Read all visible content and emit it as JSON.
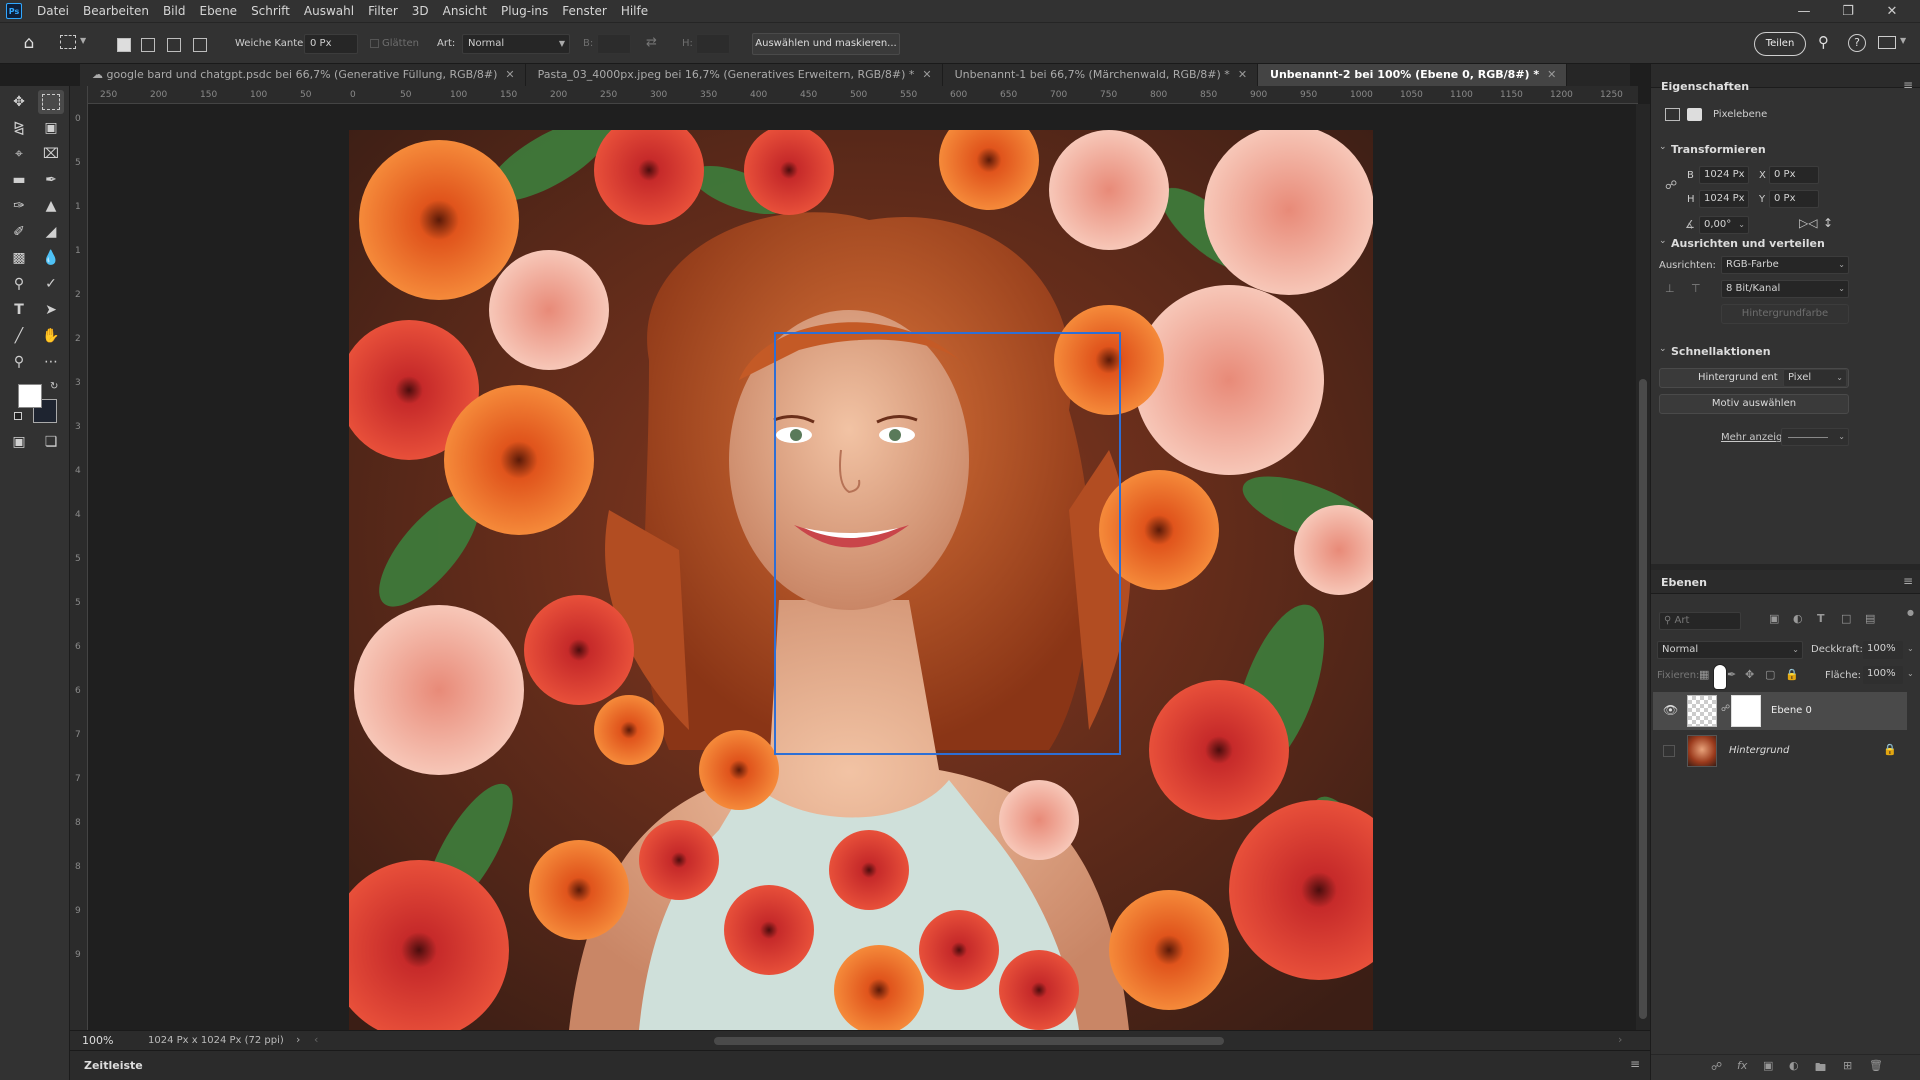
{
  "menu": {
    "app_icon": "Ps",
    "items": [
      "Datei",
      "Bearbeiten",
      "Bild",
      "Ebene",
      "Schrift",
      "Auswahl",
      "Filter",
      "3D",
      "Ansicht",
      "Plug-ins",
      "Fenster",
      "Hilfe"
    ]
  },
  "options": {
    "weiche_kante_label": "Weiche Kante:",
    "weiche_kante_value": "0 Px",
    "glaetten_label": "Glätten",
    "art_label": "Art:",
    "art_value": "Normal",
    "b_label": "B:",
    "h_label": "H:",
    "select_mask_button": "Auswählen und maskieren...",
    "share_button": "Teilen"
  },
  "tabs": [
    {
      "label": "google bard und chatgpt.psdc bei 66,7% (Generative Füllung, RGB/8#)",
      "cloud": true
    },
    {
      "label": "Pasta_03_4000px.jpeg bei 16,7% (Generatives Erweitern, RGB/8#) *"
    },
    {
      "label": "Unbenannt-1 bei 66,7% (Märchenwald, RGB/8#) *"
    },
    {
      "label": "Unbenannt-2 bei 100% (Ebene 0, RGB/8#) *",
      "active": true
    }
  ],
  "rulers": {
    "top": [
      "250",
      "200",
      "150",
      "100",
      "50",
      "0",
      "50",
      "100",
      "150",
      "200",
      "250",
      "300",
      "350",
      "400",
      "450",
      "500",
      "550",
      "600",
      "650",
      "700",
      "750",
      "800",
      "850",
      "900",
      "950",
      "1000",
      "1050",
      "1100",
      "1150",
      "1200",
      "1250"
    ],
    "left": [
      "0",
      "5",
      "1",
      "1",
      "2",
      "2",
      "3",
      "3",
      "4",
      "4",
      "5",
      "5",
      "6",
      "6",
      "7",
      "7",
      "8",
      "8",
      "9",
      "9"
    ]
  },
  "properties": {
    "title": "Eigenschaften",
    "layer_type": "Pixelebene",
    "transform_title": "Transformieren",
    "b_label": "B",
    "b_value": "1024 Px",
    "h_label": "H",
    "h_value": "1024 Px",
    "x_label": "X",
    "x_value": "0 Px",
    "y_label": "Y",
    "y_value": "0 Px",
    "angle_value": "0,00°",
    "align_title": "Ausrichten und verteilen",
    "align_label": "Ausrichten:",
    "align_value": "RGB-Farbe",
    "bit_value": "8 Bit/Kanal",
    "bg_color_button": "Hintergrundfarbe",
    "quick_title": "Schnellaktionen",
    "remove_bg_button": "Hintergrund ent",
    "pixel_value": "Pixel",
    "select_subject_button": "Motiv auswählen",
    "more_link": "Mehr anzeig"
  },
  "layers": {
    "title": "Ebenen",
    "search_placeholder": "Art",
    "blend_mode": "Normal",
    "opacity_label": "Deckkraft:",
    "opacity_value": "100%",
    "fixieren_label": "Fixieren:",
    "fill_label": "Fläche:",
    "fill_value": "100%",
    "items": [
      {
        "name": "Ebene 0",
        "visible": true,
        "selected": true
      },
      {
        "name": "Hintergrund",
        "visible": false,
        "locked": true
      }
    ]
  },
  "status": {
    "zoom": "100%",
    "doc_info": "1024 Px x 1024 Px (72 ppi)"
  },
  "timeline_label": "Zeitleiste",
  "colors": {
    "accent": "#2d6fd6",
    "app_bg": "#1e1e1e",
    "panel_bg": "#323232"
  }
}
